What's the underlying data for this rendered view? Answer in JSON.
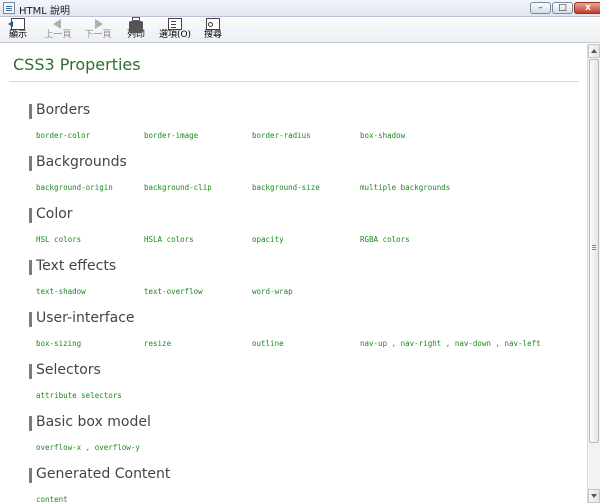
{
  "window": {
    "title": "HTML 說明",
    "controls": {
      "minimize": "–",
      "maximize": "□",
      "close": "x"
    }
  },
  "toolbar": {
    "items": [
      {
        "label": "顯示",
        "icon": "show-panel-icon",
        "enabled": true
      },
      {
        "label": "上一頁",
        "icon": "back-arrow-icon",
        "enabled": false
      },
      {
        "label": "下一頁",
        "icon": "forward-arrow-icon",
        "enabled": false
      },
      {
        "label": "列印",
        "icon": "printer-icon",
        "enabled": true
      },
      {
        "label": "選項(O)",
        "icon": "options-icon",
        "enabled": true
      },
      {
        "label": "搜尋",
        "icon": "find-icon",
        "enabled": true
      }
    ]
  },
  "page": {
    "title": "CSS3 Properties",
    "title_color": "#2d6f2d",
    "link_color": "#1a8a1a",
    "sections": [
      {
        "title": "Borders",
        "links": [
          "border-color",
          "border-image",
          "border-radius",
          "box-shadow"
        ]
      },
      {
        "title": "Backgrounds",
        "links": [
          "background-origin",
          "background-clip",
          "background-size",
          "multiple backgrounds"
        ]
      },
      {
        "title": "Color",
        "links": [
          "HSL colors",
          "HSLA colors",
          "opacity",
          "RGBA colors"
        ]
      },
      {
        "title": "Text effects",
        "links": [
          "text-shadow",
          "text-overflow",
          "word-wrap"
        ]
      },
      {
        "title": "User-interface",
        "links": [
          "box-sizing",
          "resize",
          "outline",
          "nav-up , nav-right , nav-down , nav-left"
        ]
      },
      {
        "title": "Selectors",
        "links": [
          "attribute selectors"
        ]
      },
      {
        "title": "Basic box model",
        "links": [
          "overflow-x , overflow-y"
        ]
      },
      {
        "title": "Generated Content",
        "links": [
          "content"
        ]
      }
    ]
  }
}
